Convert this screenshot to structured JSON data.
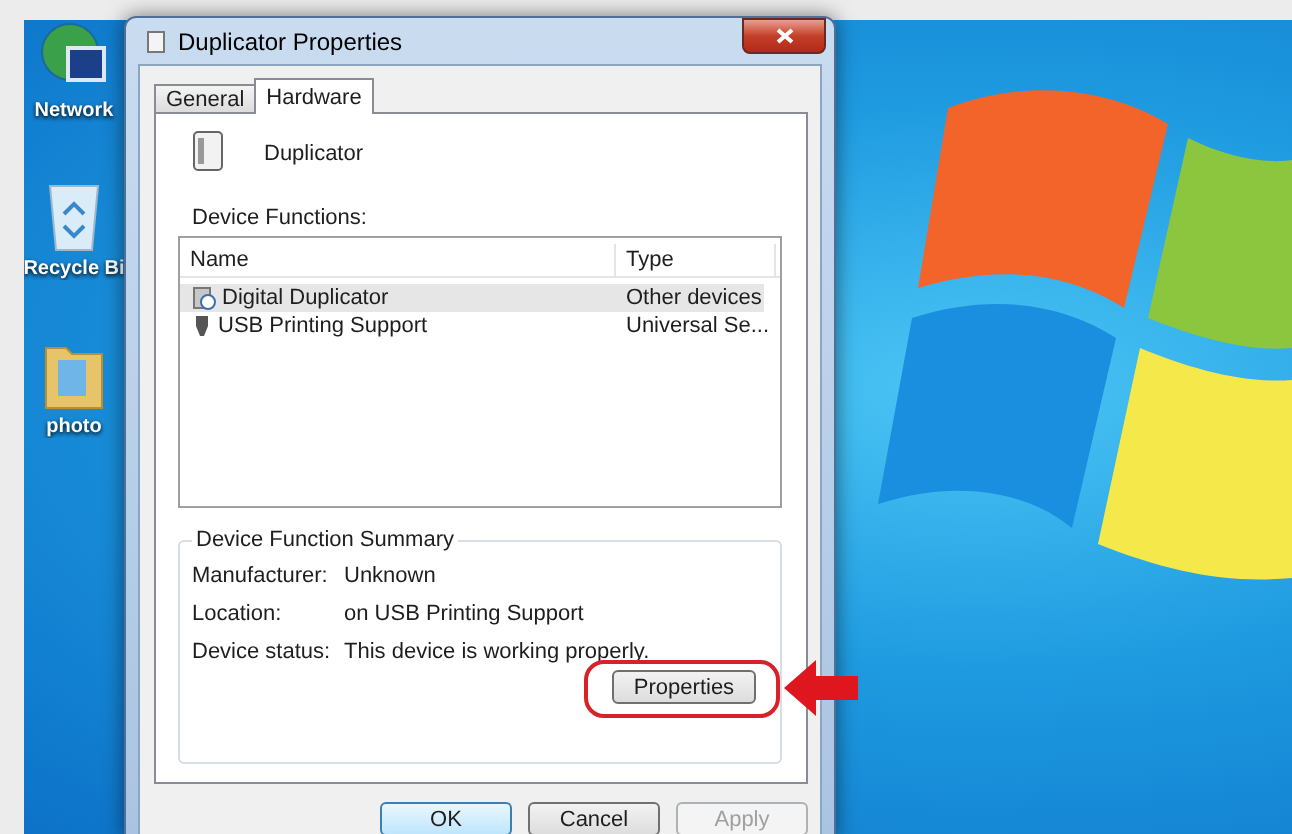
{
  "desktop_icons": [
    {
      "label": "Network",
      "kind": "network"
    },
    {
      "label": "Recycle Bi",
      "kind": "bin"
    },
    {
      "label": "photo",
      "kind": "folder"
    }
  ],
  "window": {
    "title": "Duplicator Properties"
  },
  "tabs": [
    {
      "label": "General",
      "selected": false
    },
    {
      "label": "Hardware",
      "selected": true
    }
  ],
  "device": {
    "name": "Duplicator"
  },
  "functions": {
    "label": "Device Functions:",
    "columns": [
      "Name",
      "Type"
    ],
    "rows": [
      {
        "name": "Digital Duplicator",
        "type": "Other devices",
        "kind": "unknown",
        "selected": true
      },
      {
        "name": "USB Printing Support",
        "type": "Universal Se...",
        "kind": "usb",
        "selected": false
      }
    ]
  },
  "summary": {
    "title": "Device Function Summary",
    "fields": [
      {
        "label": "Manufacturer:",
        "value": "Unknown"
      },
      {
        "label": "Location:",
        "value": "on USB Printing Support"
      },
      {
        "label": "Device status:",
        "value": "This device is working properly."
      }
    ]
  },
  "properties_button": {
    "label": "Properties"
  },
  "buttons": [
    {
      "label": "OK",
      "default": true,
      "disabled": false
    },
    {
      "label": "Cancel",
      "default": false,
      "disabled": false
    },
    {
      "label": "Apply",
      "default": false,
      "disabled": true
    }
  ]
}
